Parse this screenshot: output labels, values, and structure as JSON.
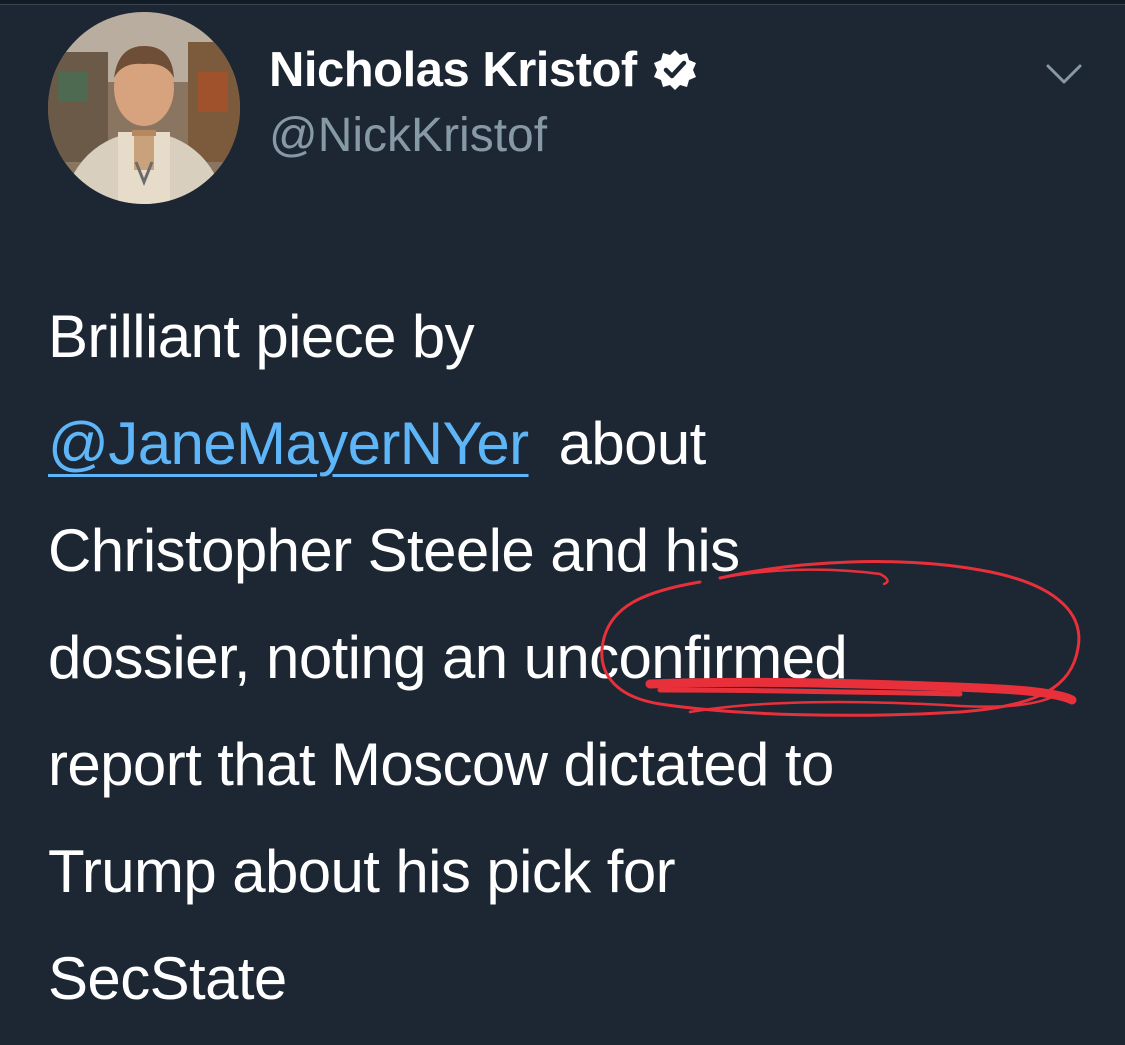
{
  "user": {
    "display_name": "Nicholas Kristof",
    "handle": "@NickKristof",
    "verified": true,
    "avatar_icon": "profile-photo"
  },
  "tweet": {
    "line1": "Brilliant piece by",
    "mention": "@JaneMayerNYer",
    "line2_rest": " about",
    "line3": "Christopher Steele and his",
    "line4": "dossier, noting an unconfirmed",
    "line5": "report that Moscow dictated to",
    "line6": "Trump about his pick for",
    "line7": "SecState"
  },
  "icons": {
    "verified": "verified-badge-icon",
    "menu": "chevron-down-icon"
  },
  "colors": {
    "background": "#1c2733",
    "text": "#ffffff",
    "handle": "#8899a6",
    "link": "#5eb5f7",
    "annotation": "#e8303a"
  }
}
